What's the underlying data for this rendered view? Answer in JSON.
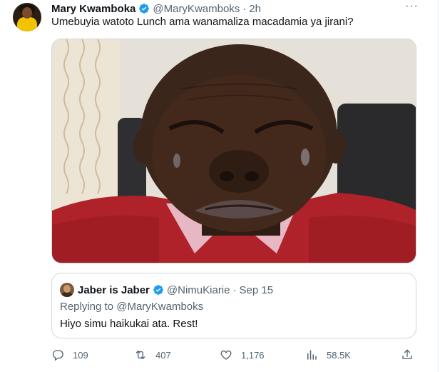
{
  "tweet": {
    "author_name": "Mary Kwamboka",
    "author_handle": "@MaryKwamboks",
    "separator": "·",
    "time": "2h",
    "text": "Umebuyia watoto Lunch ama wanamaliza macadamia ya jirani?",
    "more_label": "···",
    "verified_color": "#1d9bf0"
  },
  "quote": {
    "author_name": "Jaber is Jaber",
    "author_handle": "@NimuKiarie",
    "separator": "·",
    "date": "Sep 15",
    "replying_prefix": "Replying to",
    "replying_to": "@MaryKwamboks",
    "text": "Hiyo simu haikukai ata. Rest!"
  },
  "actions": {
    "replies": "109",
    "retweets": "407",
    "likes": "1,176",
    "views": "58.5K"
  },
  "icons": [
    "reply-icon",
    "retweet-icon",
    "like-icon",
    "views-icon",
    "share-icon",
    "verified-icon",
    "more-icon"
  ],
  "colors": {
    "text_primary": "#0f1419",
    "text_secondary": "#536471",
    "border": "#cfd9de",
    "verified": "#1d9bf0"
  }
}
